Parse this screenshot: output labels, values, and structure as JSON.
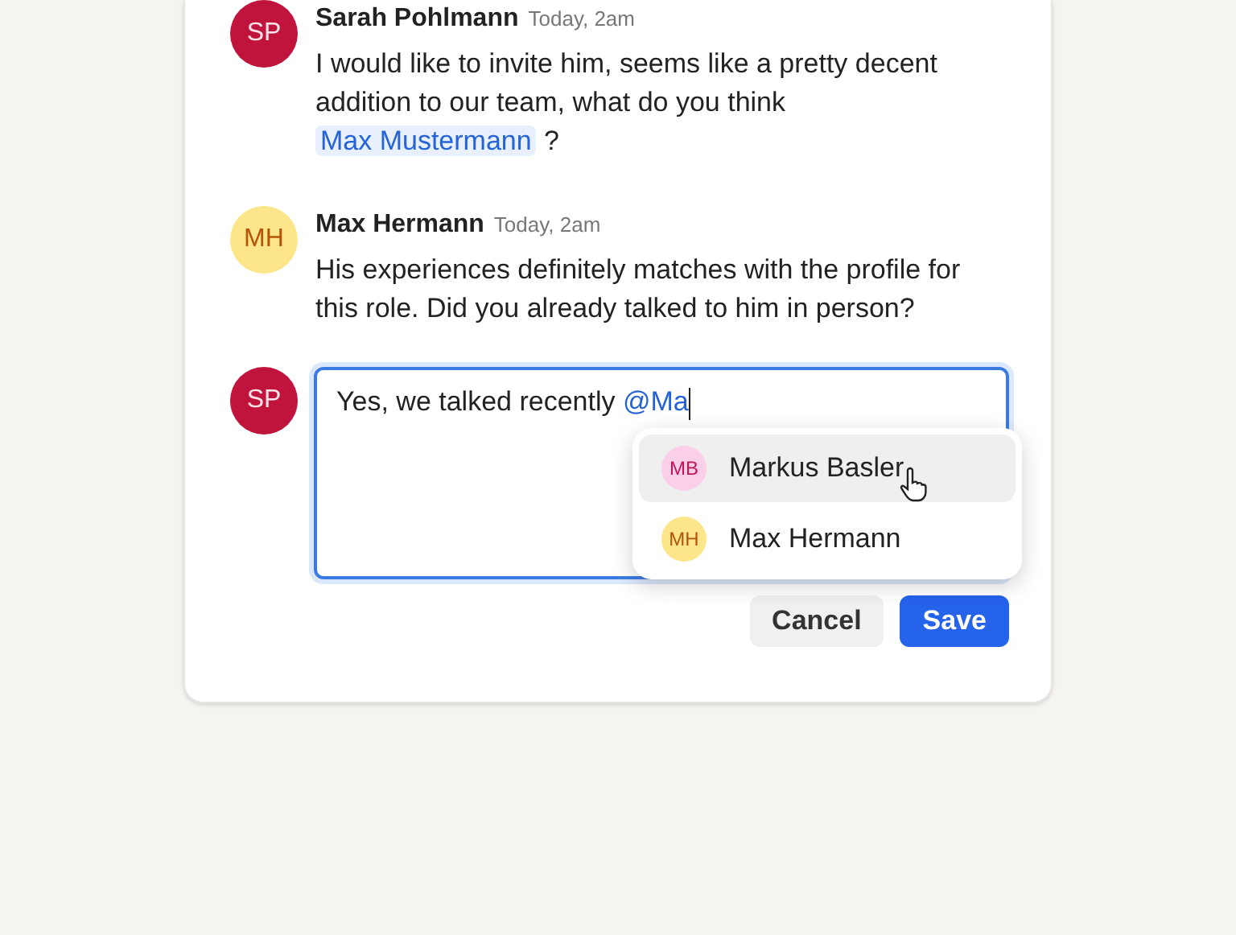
{
  "comments": [
    {
      "initials": "SP",
      "color": "#c0143c",
      "author": "Sarah Pohlmann",
      "time": "Today, 2am",
      "parts": [
        {
          "kind": "plain",
          "text": "I would like to invite him, seems like a pretty decent addition to our team, what do you think "
        },
        {
          "kind": "mention",
          "text": "Max Mustermann"
        },
        {
          "kind": "plain",
          "text": " ?"
        }
      ]
    },
    {
      "initials": "MH",
      "color": "#fde68a",
      "author": "Max Hermann",
      "time": "Today, 2am",
      "parts": [
        {
          "kind": "plain",
          "text": "His experiences definitely matches with the profile for this role. Did you already talked to him in person?"
        }
      ]
    }
  ],
  "composer": {
    "initials": "SP",
    "color": "#c0143c",
    "value": "Yes, we talked recently ",
    "mention_query": "@Ma",
    "suggestions": [
      {
        "initials": "MB",
        "color": "#fbcfe8",
        "name": "Markus Basler",
        "selected": true
      },
      {
        "initials": "MH",
        "color": "#fde68a",
        "name": "Max Hermann",
        "selected": false
      }
    ]
  },
  "buttons": [
    {
      "kind": "secondary",
      "label": "Cancel"
    },
    {
      "kind": "primary",
      "label": "Save"
    }
  ]
}
